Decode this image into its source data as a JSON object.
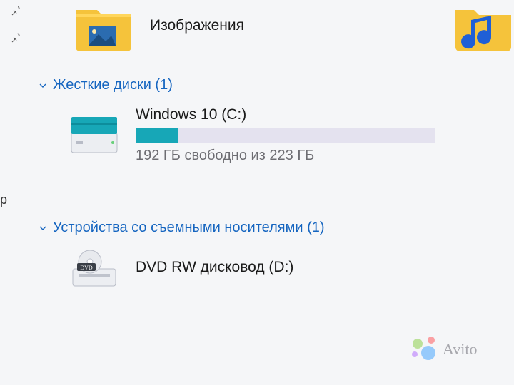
{
  "sidebar_partial": "р",
  "folders": {
    "pictures_label": "Изображения"
  },
  "groups": {
    "hdd": {
      "title": "Жесткие диски (1)",
      "count": 1
    },
    "removable": {
      "title": "Устройства со съемными носителями (1)",
      "count": 1
    }
  },
  "drives": {
    "c": {
      "name": "Windows 10 (C:)",
      "status": "192 ГБ свободно из 223 ГБ",
      "free_gb": 192,
      "total_gb": 223,
      "used_percent": 14
    },
    "d": {
      "name": "DVD RW дисковод (D:)"
    }
  },
  "watermark": "Avito"
}
